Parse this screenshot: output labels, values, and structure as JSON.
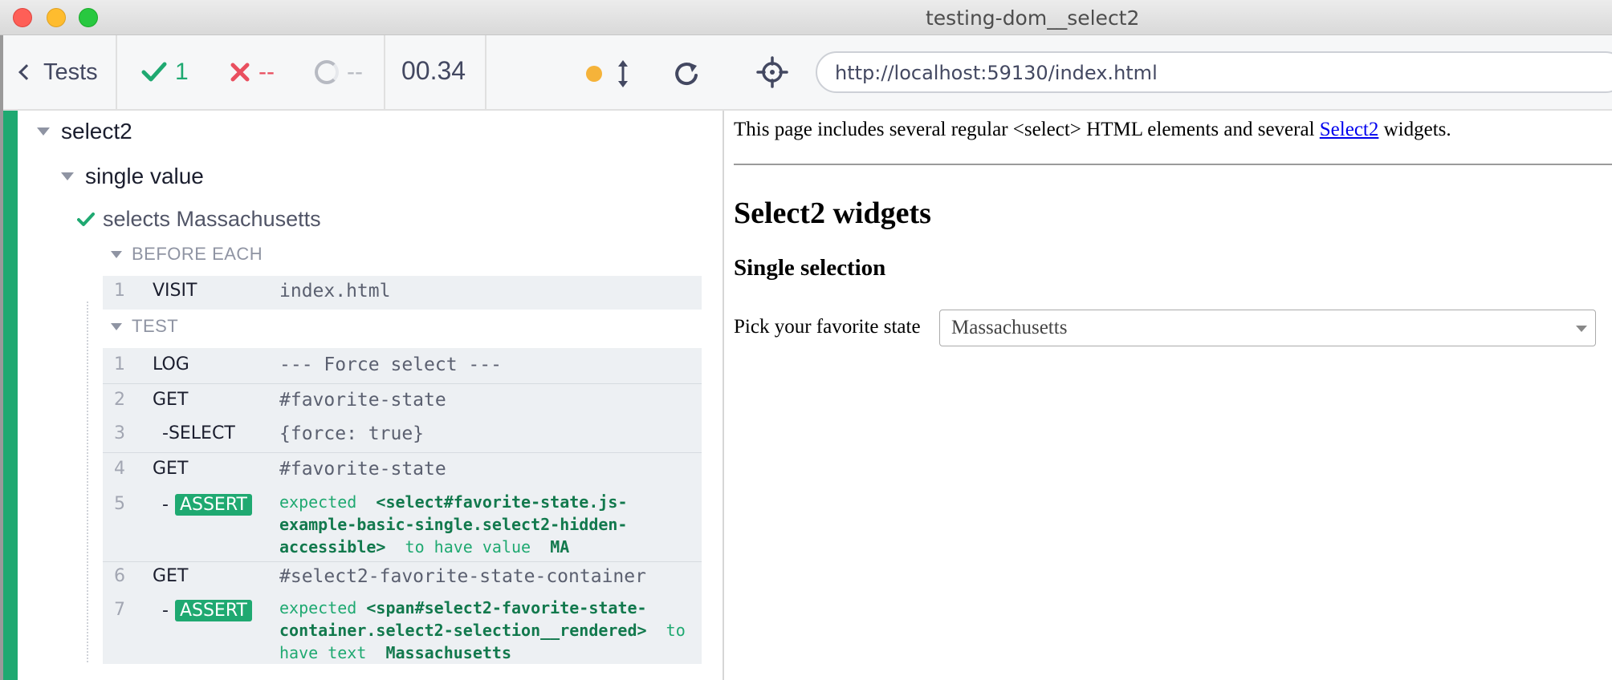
{
  "window": {
    "title": "testing-dom__select2"
  },
  "reporter": {
    "tests_label": "Tests",
    "passed": "1",
    "failed": "--",
    "pending": "--",
    "duration": "00.34",
    "suite": "select2",
    "sub_suite": "single value",
    "test_title": "selects Massachusetts",
    "before_each_label": "BEFORE EACH",
    "test_label": "TEST",
    "before_each_commands": [
      {
        "num": "1",
        "name": "VISIT",
        "message": "index.html"
      }
    ],
    "commands": [
      {
        "num": "1",
        "name": "LOG",
        "message": "--- Force select ---"
      },
      {
        "num": "2",
        "name": "GET",
        "message": "#favorite-state"
      },
      {
        "num": "3",
        "name": "-SELECT",
        "message": "{force: true}"
      },
      {
        "num": "4",
        "name": "GET",
        "message": "#favorite-state"
      },
      {
        "num": "5",
        "name": "-",
        "badge": "ASSERT",
        "expected": "expected",
        "subject": "<select#favorite-state.js-example-basic-single.select2-hidden-accessible>",
        "subject_l1": "<select#favorite-state.js-",
        "subject_l2": "example-basic-single.select2-hidden-",
        "subject_l3": "accessible>",
        "verb": "to have value",
        "value": "MA"
      },
      {
        "num": "6",
        "name": "GET",
        "message": "#select2-favorite-state-container"
      },
      {
        "num": "7",
        "name": "-",
        "badge": "ASSERT",
        "expected": "expected",
        "subject_l1": "<span#select2-favorite-state-",
        "subject_l2": "container.select2-selection__rendered>",
        "verb_l2": "to",
        "verb_l3": "have text",
        "value": "Massachusetts"
      }
    ]
  },
  "app": {
    "url": "http://localhost:59130/index.html",
    "intro_before": "This page includes several regular <select> HTML elements and several ",
    "intro_link": "Select2",
    "intro_after": " widgets.",
    "heading": "Select2 widgets",
    "subheading": "Single selection",
    "field_label": "Pick your favorite state",
    "selected_state": "Massachusetts"
  },
  "colors": {
    "pass": "#1fa971",
    "fail": "#e94f5f",
    "pending": "#b7bac2",
    "running_dot": "#f5b33a",
    "link": "#0000ee"
  }
}
